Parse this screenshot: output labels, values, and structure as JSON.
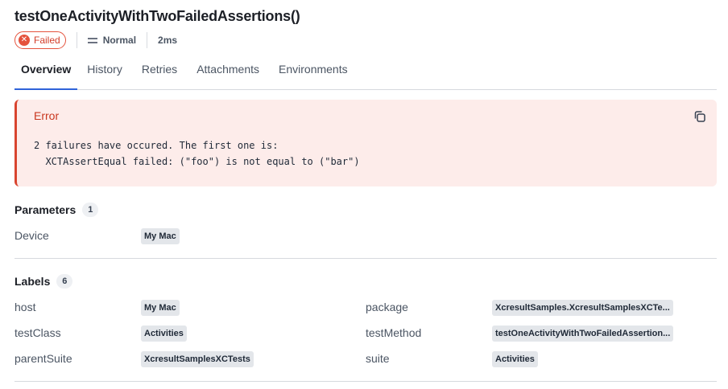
{
  "header": {
    "title": "testOneActivityWithTwoFailedAssertions()",
    "status_label": "Failed",
    "status_icon": "x-circle-icon",
    "severity_label": "Normal",
    "severity_icon": "equals-icon",
    "duration": "2ms"
  },
  "tabs": [
    {
      "label": "Overview",
      "active": true
    },
    {
      "label": "History",
      "active": false
    },
    {
      "label": "Retries",
      "active": false
    },
    {
      "label": "Attachments",
      "active": false
    },
    {
      "label": "Environments",
      "active": false
    }
  ],
  "error": {
    "title": "Error",
    "message": "2 failures have occured. The first one is:\n  XCTAssertEqual failed: (\"foo\") is not equal to (\"bar\")",
    "copy_icon": "copy-icon"
  },
  "parameters": {
    "title": "Parameters",
    "count": "1",
    "items": [
      {
        "key": "Device",
        "value": "My Mac"
      }
    ]
  },
  "labels": {
    "title": "Labels",
    "count": "6",
    "items": [
      {
        "key": "host",
        "value": "My Mac"
      },
      {
        "key": "package",
        "value": "XcresultSamples.XcresultSamplesXCTe..."
      },
      {
        "key": "testClass",
        "value": "Activities"
      },
      {
        "key": "testMethod",
        "value": "testOneActivityWithTwoFailedAssertion..."
      },
      {
        "key": "parentSuite",
        "value": "XcresultSamplesXCTests"
      },
      {
        "key": "suite",
        "value": "Activities"
      }
    ]
  },
  "colors": {
    "failed": "#e5533d",
    "error_bg": "#fdecea",
    "active_tab": "#2f63d9"
  }
}
